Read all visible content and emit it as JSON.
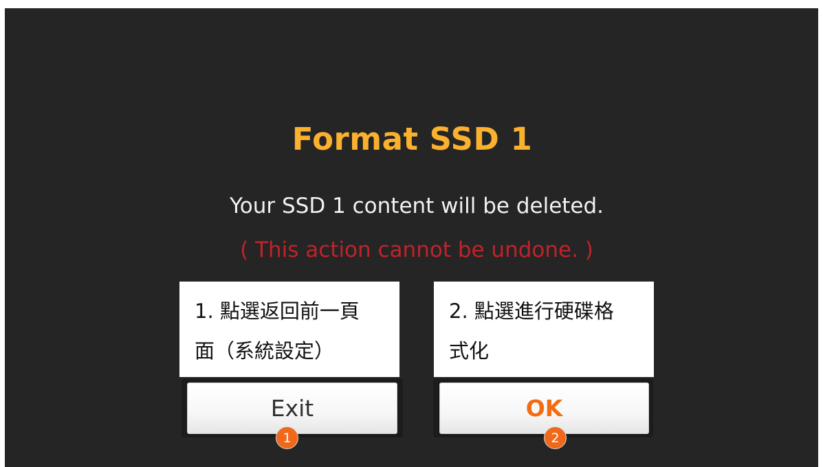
{
  "dialog": {
    "title": "Format SSD 1",
    "message": "Your SSD 1 content will be deleted.",
    "warning": "( This action cannot be undone. )"
  },
  "annotations": [
    {
      "line1": "1. 點選返回前一頁",
      "line2": "面（系統設定）"
    },
    {
      "line1": "2. 點選進行硬碟格",
      "line2": "式化"
    }
  ],
  "buttons": {
    "exit_label": "Exit",
    "ok_label": "OK"
  },
  "badges": {
    "exit_step": "1",
    "ok_step": "2"
  },
  "colors": {
    "background": "#252525",
    "title": "#fbb12e",
    "warning": "#c0232a",
    "ok_text": "#f26c12",
    "badge": "#f0691a"
  }
}
